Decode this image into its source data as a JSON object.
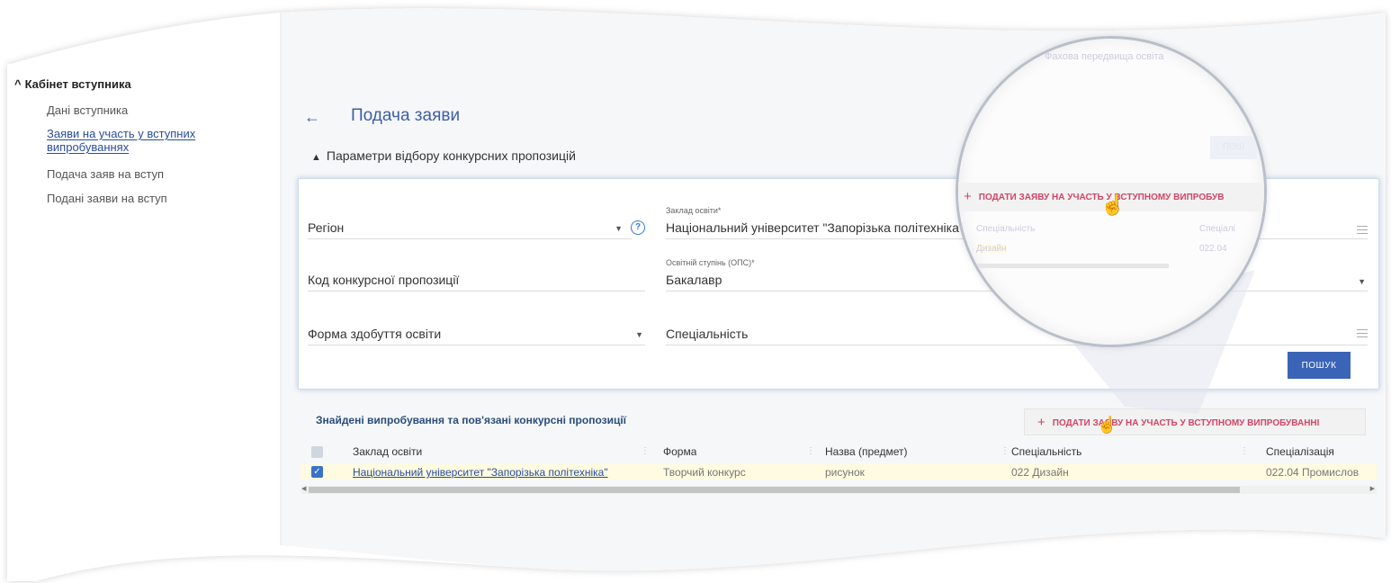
{
  "sidebar": {
    "section_title": "Кабінет вступника",
    "items": [
      {
        "label": "Дані вступника"
      },
      {
        "label": "Заяви на участь у вступних"
      },
      {
        "label": "випробуваннях"
      },
      {
        "label": "Подача заяв на вступ"
      },
      {
        "label": "Подані заяви на вступ"
      }
    ]
  },
  "header": {
    "back_arrow": "←",
    "title": "Подача заяви",
    "faded_text": "Фахова передвища освіта"
  },
  "params": {
    "section_title": "Параметри відбору конкурсних пропозицій",
    "region_label": "Регіон",
    "help_glyph": "?",
    "institution_label": "Заклад освіти*",
    "institution_value": "Національний університет \"Запорізька політехніка\"",
    "code_label": "Код конкурсної пропозиції",
    "degree_label": "Освітній ступінь (ОПС)*",
    "degree_value": "Бакалавр",
    "form_label": "Форма здобуття освіти",
    "specialty_label": "Спеціальність",
    "search_button": "ПОШУК"
  },
  "results": {
    "title": "Знайдені випробування та пов'язані конкурсні пропозиції",
    "apply_button": "ПОДАТИ ЗАЯВУ НА УЧАСТЬ У ВСТУПНОМУ ВИПРОБУВАННІ",
    "columns": [
      "Заклад освіти",
      "Форма",
      "Назва (предмет)",
      "Спеціальність",
      "Спеціалізація"
    ],
    "row": {
      "institution": "Національний університет \"Запорізька політехніка\"",
      "form": "Творчий конкурс",
      "subject": "рисунок",
      "specialty": "022 Дизайн",
      "specialization": "022.04 Промислов"
    }
  },
  "magnifier": {
    "apply_button": "ПОДАТИ ЗАЯВУ НА УЧАСТЬ У ВСТУПНОМУ ВИПРОБУВ",
    "faded_specialty": "Спеціальність",
    "faded_specialization": "Спеціалі",
    "faded_value": "Дизайн",
    "faded_code": "022.04",
    "faded_button": "ПОШ"
  },
  "colors": {
    "title_blue": "#3d5ea8",
    "primary_button": "#3a64b8",
    "apply_text": "#d24566",
    "selected_row": "#fffbe0"
  }
}
